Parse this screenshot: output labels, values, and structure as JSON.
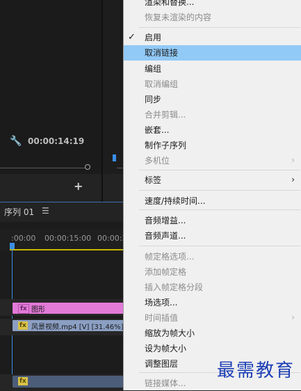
{
  "source_monitor": {
    "timecode": "00:00:14:19",
    "wrench_icon": "wrench-icon",
    "add_icon": "plus-icon"
  },
  "timeline": {
    "sequence_tab": "序列 01",
    "tab_menu_icon": "hamburger-icon",
    "ruler_ticks": [
      ":00:00",
      "00:00:15:00",
      "00:00:3"
    ],
    "clips": {
      "graphic": {
        "fx": "fx",
        "label": "图形"
      },
      "video": {
        "fx": "fx",
        "label": "风景视频.mp4 [V] [31.46%]"
      },
      "video2": {
        "fx": "fx"
      }
    }
  },
  "context_menu": {
    "items": [
      {
        "label": "渲染和替换...",
        "enabled": true
      },
      {
        "label": "恢复未渲染的内容",
        "enabled": false
      },
      {
        "label": "启用",
        "enabled": true,
        "checked": true
      },
      {
        "label": "取消链接",
        "enabled": true,
        "highlighted": true
      },
      {
        "label": "编组",
        "enabled": true
      },
      {
        "label": "取消编组",
        "enabled": false
      },
      {
        "label": "同步",
        "enabled": true
      },
      {
        "label": "合并剪辑...",
        "enabled": false
      },
      {
        "label": "嵌套...",
        "enabled": true
      },
      {
        "label": "制作子序列",
        "enabled": true
      },
      {
        "label": "多机位",
        "enabled": false,
        "submenu": true
      },
      {
        "label": "标签",
        "enabled": true,
        "submenu": true
      },
      {
        "label": "速度/持续时间...",
        "enabled": true
      },
      {
        "label": "音频增益...",
        "enabled": true
      },
      {
        "label": "音频声道...",
        "enabled": true
      },
      {
        "label": "帧定格选项...",
        "enabled": false
      },
      {
        "label": "添加帧定格",
        "enabled": false
      },
      {
        "label": "插入帧定格分段",
        "enabled": false
      },
      {
        "label": "场选项...",
        "enabled": true
      },
      {
        "label": "时间插值",
        "enabled": false,
        "submenu": true
      },
      {
        "label": "缩放为帧大小",
        "enabled": true
      },
      {
        "label": "设为帧大小",
        "enabled": true
      },
      {
        "label": "调整图层",
        "enabled": true
      },
      {
        "label": "链接媒体...",
        "enabled": false
      }
    ],
    "checkmark": "✓",
    "submenu_arrow": "›"
  },
  "watermark": "最需教育"
}
